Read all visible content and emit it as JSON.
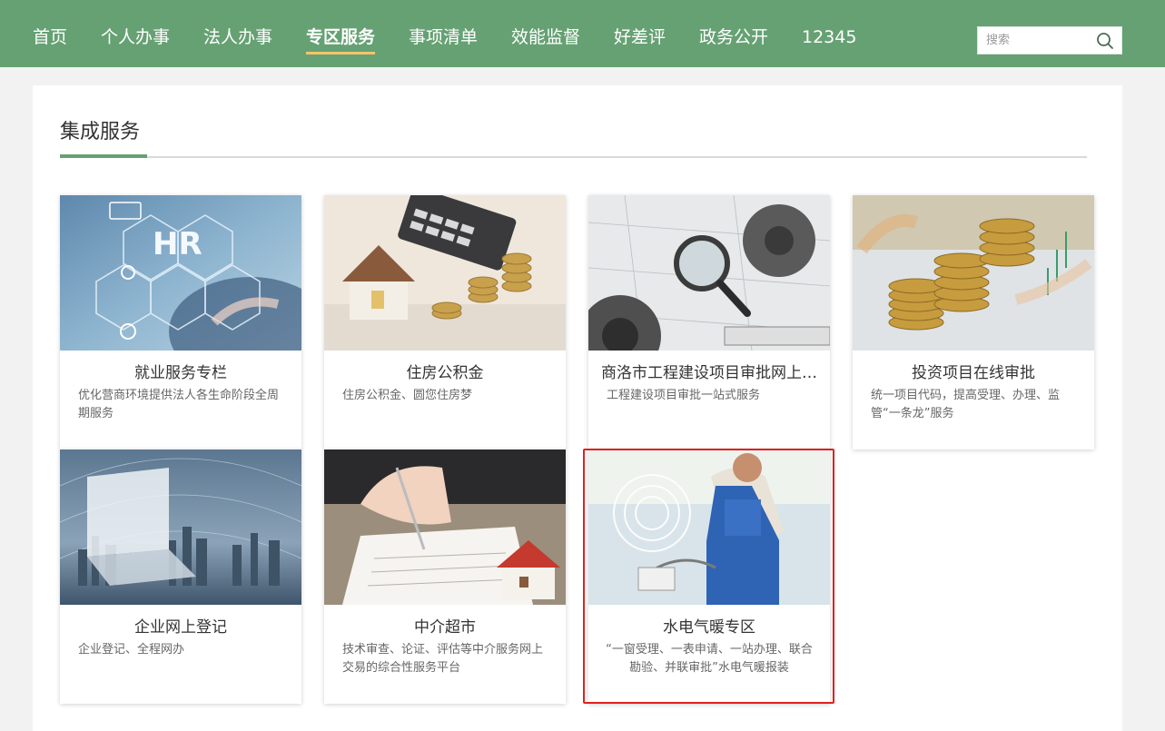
{
  "nav": {
    "items": [
      {
        "label": "首页"
      },
      {
        "label": "个人办事"
      },
      {
        "label": "法人办事"
      },
      {
        "label": "专区服务",
        "active": true
      },
      {
        "label": "事项清单"
      },
      {
        "label": "效能监督"
      },
      {
        "label": "好差评"
      },
      {
        "label": "政务公开"
      },
      {
        "label": "12345"
      }
    ],
    "search": {
      "placeholder": "搜索",
      "icon": "search-icon"
    }
  },
  "section": {
    "title": "集成服务"
  },
  "cards": [
    {
      "title": "就业服务专栏",
      "desc": "优化营商环境提供法人各生命阶段全周期服务",
      "image": "hr-network-image"
    },
    {
      "title": "住房公积金",
      "desc": "住房公积金、圆您住房梦",
      "image": "house-coins-image"
    },
    {
      "title": "商洛市工程建设项目审批网上…",
      "desc": "工程建设项目审批一站式服务",
      "image": "blueprint-gears-image"
    },
    {
      "title": "投资项目在线审批",
      "desc": "统一项目代码，提高受理、办理、监管“一条龙”服务",
      "image": "coins-chart-image"
    },
    {
      "title": "企业网上登记",
      "desc": "企业登记、全程网办",
      "image": "laptop-city-image"
    },
    {
      "title": "中介超市",
      "desc": "技术审查、论证、评估等中介服务网上交易的综合性服务平台",
      "image": "contract-house-image"
    },
    {
      "title": "水电气暖专区",
      "desc": "“一窗受理、一表申请、一站办理、联合勘验、并联审批”水电气暖报装",
      "image": "electrician-image"
    }
  ],
  "colors": {
    "header": "#66a173",
    "accent_underline": "#f3c56b",
    "highlight_border": "#e02020"
  }
}
